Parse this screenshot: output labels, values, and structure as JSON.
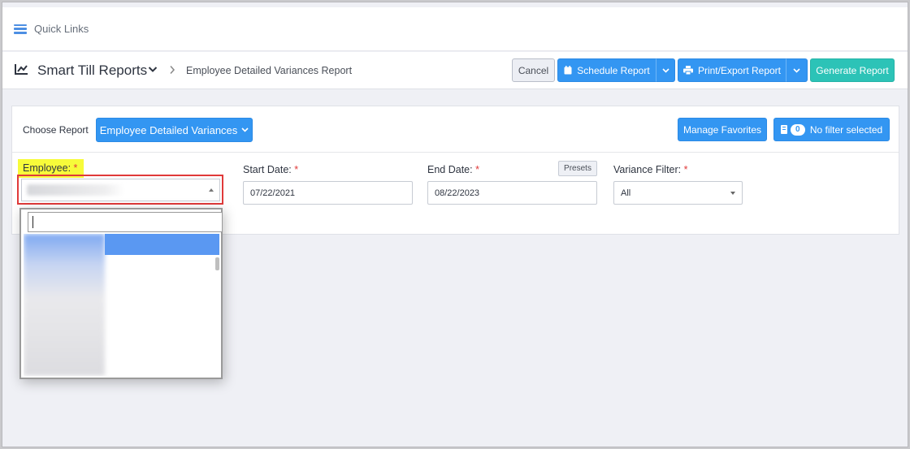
{
  "quick_links": {
    "label": "Quick Links",
    "icon": "menu-icon"
  },
  "header": {
    "app_title": "Smart Till Reports",
    "breadcrumb": "Employee Detailed Variances Report",
    "buttons": {
      "cancel": "Cancel",
      "schedule": "Schedule Report",
      "print": "Print/Export Report",
      "generate": "Generate Report"
    }
  },
  "report": {
    "choose_label": "Choose Report",
    "selected_report": "Employee Detailed Variances",
    "manage_favorites": "Manage Favorites",
    "filter_count": "0",
    "filter_text": "No filter selected"
  },
  "fields": {
    "employee_label": "Employee:",
    "start_label": "Start Date:",
    "start_value": "07/22/2021",
    "end_label": "End Date:",
    "end_value": "08/22/2023",
    "presets": "Presets",
    "variance_label": "Variance Filter:",
    "variance_value": "All",
    "required_mark": "*"
  },
  "colors": {
    "primary": "#3396f2",
    "teal": "#2cc3b7",
    "required": "#e03a3a",
    "highlight": "#f7fb3a"
  }
}
